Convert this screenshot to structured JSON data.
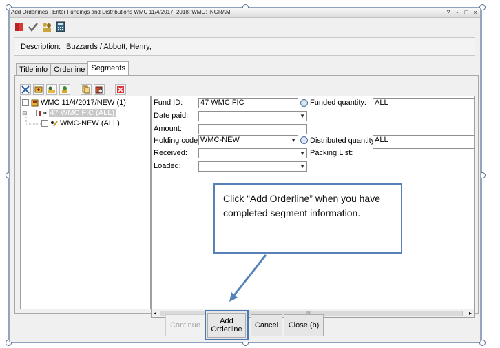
{
  "window": {
    "title": "Add Orderlines : Enter Fundings and Distributions   WMC 11/4/2017; 2018; WMC; INGRAM",
    "controls": [
      "?",
      "-",
      "□",
      "×"
    ]
  },
  "description": {
    "label": "Description:",
    "value": "Buzzards / Abbott, Henry,"
  },
  "tabs": [
    "Title info",
    "Orderline",
    "Segments"
  ],
  "tree": {
    "root": "WMC 11/4/2017/NEW (1)",
    "funding": "47 WMC FIC (ALL)",
    "distribution": "WMC-NEW (ALL)"
  },
  "form": {
    "fund_id_label": "Fund ID:",
    "fund_id": "47 WMC FIC",
    "date_paid_label": "Date paid:",
    "amount_label": "Amount:",
    "holding_code_label": "Holding code:",
    "holding_code": "WMC-NEW",
    "received_label": "Received:",
    "loaded_label": "Loaded:",
    "funded_qty_label": "Funded quantity:",
    "funded_qty": "ALL",
    "distributed_qty_label": "Distributed quantity:",
    "distributed_qty": "ALL",
    "packing_list_label": "Packing List:"
  },
  "buttons": {
    "continue": "Continue",
    "add_orderline_line1": "Add",
    "add_orderline_line2": "Orderline",
    "cancel": "Cancel",
    "close": "Close (b)"
  },
  "callout": {
    "text": "Click “Add Orderline” when you have completed segment information."
  },
  "colors": {
    "callout_border": "#5682b8",
    "selection_gray": "#c8c8c8",
    "window_bg": "#f0f0f0"
  },
  "icons": [
    "book-icon",
    "check-icon",
    "user-group-icon",
    "calculator-icon"
  ]
}
